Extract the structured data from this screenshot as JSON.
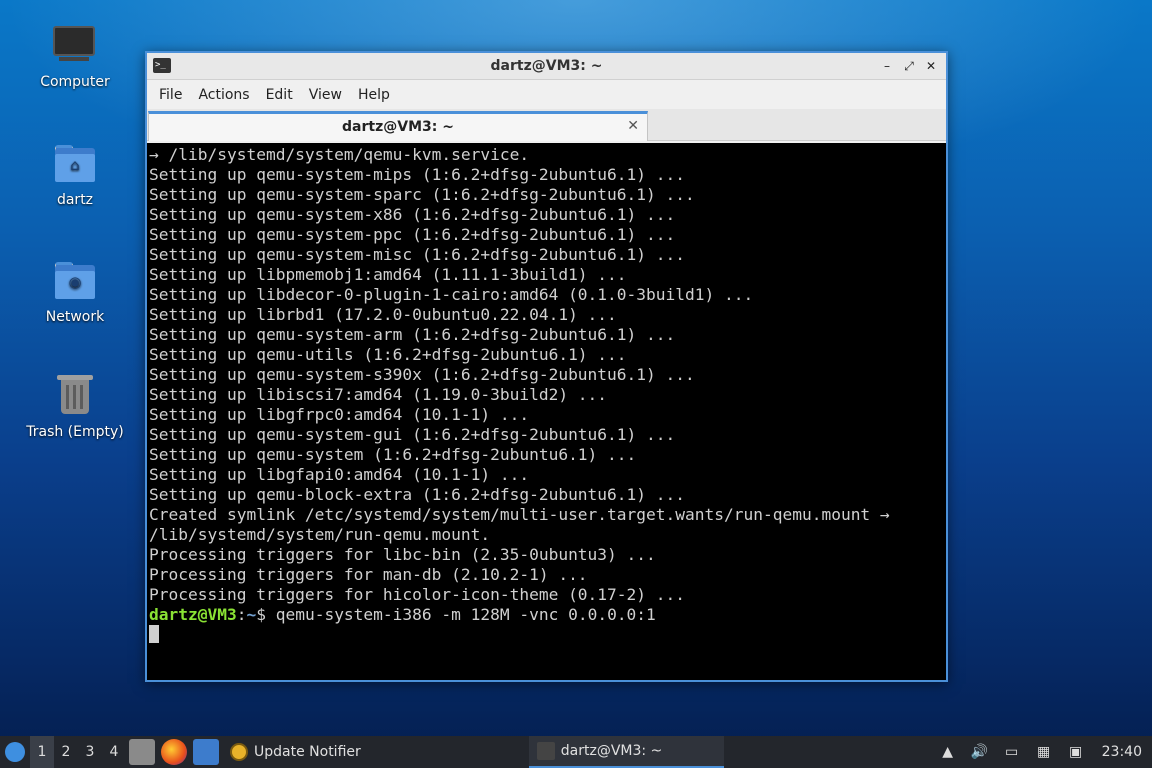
{
  "desktop": {
    "icons": [
      {
        "label": "Computer"
      },
      {
        "label": "dartz"
      },
      {
        "label": "Network"
      },
      {
        "label": "Trash (Empty)"
      }
    ]
  },
  "window": {
    "title": "dartz@VM3: ~",
    "menu": [
      "File",
      "Actions",
      "Edit",
      "View",
      "Help"
    ],
    "tab_label": "dartz@VM3: ~",
    "controls": {
      "minimize": "–",
      "maximize": "⤢",
      "close": "✕"
    }
  },
  "terminal": {
    "lines": [
      "→ /lib/systemd/system/qemu-kvm.service.",
      "Setting up qemu-system-mips (1:6.2+dfsg-2ubuntu6.1) ...",
      "Setting up qemu-system-sparc (1:6.2+dfsg-2ubuntu6.1) ...",
      "Setting up qemu-system-x86 (1:6.2+dfsg-2ubuntu6.1) ...",
      "Setting up qemu-system-ppc (1:6.2+dfsg-2ubuntu6.1) ...",
      "Setting up qemu-system-misc (1:6.2+dfsg-2ubuntu6.1) ...",
      "Setting up libpmemobj1:amd64 (1.11.1-3build1) ...",
      "Setting up libdecor-0-plugin-1-cairo:amd64 (0.1.0-3build1) ...",
      "Setting up librbd1 (17.2.0-0ubuntu0.22.04.1) ...",
      "Setting up qemu-system-arm (1:6.2+dfsg-2ubuntu6.1) ...",
      "Setting up qemu-utils (1:6.2+dfsg-2ubuntu6.1) ...",
      "Setting up qemu-system-s390x (1:6.2+dfsg-2ubuntu6.1) ...",
      "Setting up libiscsi7:amd64 (1.19.0-3build2) ...",
      "Setting up libgfrpc0:amd64 (10.1-1) ...",
      "Setting up qemu-system-gui (1:6.2+dfsg-2ubuntu6.1) ...",
      "Setting up qemu-system (1:6.2+dfsg-2ubuntu6.1) ...",
      "Setting up libgfapi0:amd64 (10.1-1) ...",
      "Setting up qemu-block-extra (1:6.2+dfsg-2ubuntu6.1) ...",
      "Created symlink /etc/systemd/system/multi-user.target.wants/run-qemu.mount →",
      "/lib/systemd/system/run-qemu.mount.",
      "Processing triggers for libc-bin (2.35-0ubuntu3) ...",
      "Processing triggers for man-db (2.10.2-1) ...",
      "Processing triggers for hicolor-icon-theme (0.17-2) ..."
    ],
    "prompt": {
      "user": "dartz@VM3",
      "sep": ":",
      "path": "~",
      "symbol": "$",
      "command": " qemu-system-i386 -m 128M -vnc 0.0.0.0:1"
    }
  },
  "taskbar": {
    "workspaces": [
      "1",
      "2",
      "3",
      "4"
    ],
    "active_workspace": "1",
    "tasks": [
      {
        "label": "Update Notifier"
      },
      {
        "label": "dartz@VM3: ~"
      }
    ],
    "clock": "23:40"
  }
}
